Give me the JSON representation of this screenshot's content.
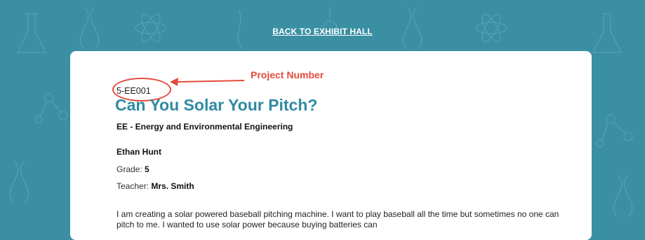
{
  "nav": {
    "back_label": "BACK TO EXHIBIT HALL"
  },
  "annotation": {
    "label": "Project Number",
    "color": "#e34b3b"
  },
  "project": {
    "number": "5-EE001",
    "title": "Can You Solar Your Pitch?",
    "category": "EE - Energy and Environmental Engineering",
    "student": "Ethan Hunt",
    "grade_label": "Grade:",
    "grade_value": "5",
    "teacher_label": "Teacher:",
    "teacher_value": "Mrs. Smith",
    "description": "I am creating a solar powered baseball pitching machine. I want to play baseball all the time but sometimes no one can pitch to me. I wanted to use solar power because buying batteries can"
  },
  "colors": {
    "background": "#3a8fa3",
    "title": "#2f8aa1",
    "card": "#ffffff"
  }
}
